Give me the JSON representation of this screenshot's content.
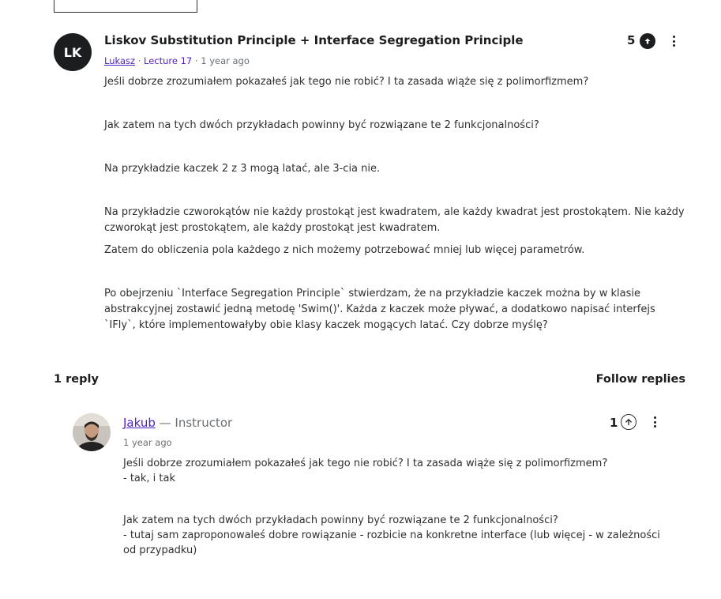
{
  "question": {
    "avatar_initials": "LK",
    "title": "Liskov Substitution Principle + Interface Segregation Principle",
    "author": "Lukasz",
    "separator1": "·",
    "lecture": "Lecture 17",
    "separator2": "·",
    "time": "1 year ago",
    "votes": "5",
    "paragraphs": [
      "Jeśli dobrze zrozumiałem pokazałeś jak tego nie robić?  I ta zasada wiąże się z polimorfizmem?",
      "Jak zatem na tych dwóch przykładach powinny być rozwiązane te 2 funkcjonalności?",
      "Na przykładzie kaczek 2 z 3 mogą latać, ale 3-cia nie.",
      "Na przykładzie czworokątów nie każdy prostokąt jest kwadratem, ale każdy kwadrat  jest prostokątem. Nie każdy czworokąt jest prostokątem, ale każdy prostokąt jest kwadratem.",
      "Zatem do obliczenia pola każdego z nich możemy potrzebować mniej lub więcej parametrów.",
      "Po obejrzeniu `Interface Segregation Principle` stwierdzam, że na przykładzie kaczek można by w klasie abstrakcyjnej zostawić jedną metodę 'Swim()'.  Każda z kaczek może pływać, a dodatkowo napisać interfejs `IFly`, które implementowałyby obie klasy kaczek mogących latać. Czy dobrze myślę?"
    ]
  },
  "replies_header": {
    "count_label": "1 reply",
    "follow_label": "Follow replies"
  },
  "reply": {
    "name": "Jakub",
    "role": " — Instructor",
    "time": "1 year ago",
    "votes": "1",
    "block1_line1": "Jeśli dobrze zrozumiałem pokazałeś jak tego nie robić? I ta zasada wiąże się z polimorfizmem?",
    "block1_line2": "- tak, i tak",
    "block2_line1": "Jak zatem na tych dwóch przykładach powinny być rozwiązane te 2 funkcjonalności?",
    "block2_line2": "- tutaj sam zaproponowaleś dobre rowiązanie - rozbicie na konkretne interface (lub więcej - w zależności od przypadku)"
  },
  "colors": {
    "accent": "#5022c3",
    "text": "#2d2f31",
    "dark": "#1c1d1f"
  },
  "icons": {
    "upvote": "arrow-up-circle-icon",
    "menu": "kebab-menu-icon"
  }
}
